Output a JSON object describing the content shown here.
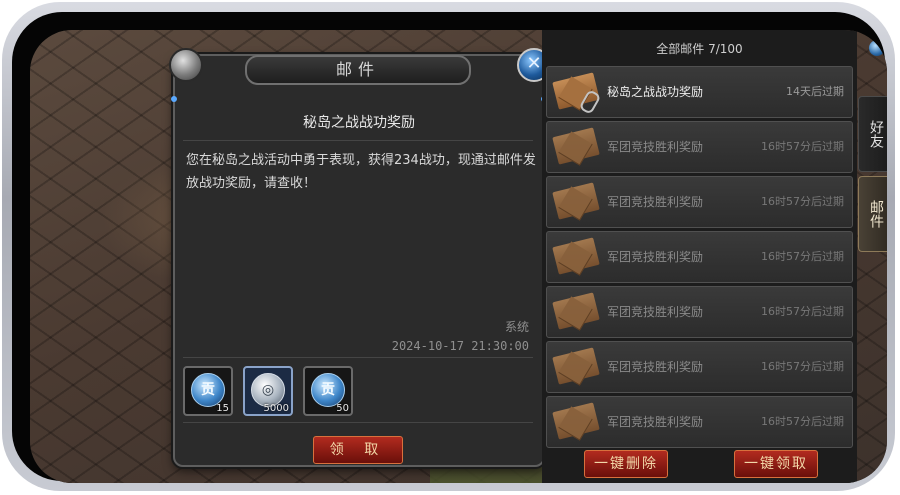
{
  "detail": {
    "window_title": "邮件",
    "close_symbol": "✕",
    "mail_title": "秘岛之战战功奖励",
    "mail_body": "您在秘岛之战活动中勇于表现，获得234战功，现通过邮件发放战功奖励，请查收！",
    "sender": "系统",
    "date": "2024-10-17 21:30:00",
    "rewards": [
      {
        "icon": "contribution-icon",
        "glyph": "贡",
        "count": "15"
      },
      {
        "icon": "silver-coin-icon",
        "glyph": "◎",
        "count": "5000"
      },
      {
        "icon": "contribution-icon",
        "glyph": "贡",
        "count": "50"
      }
    ],
    "claim_label": "领 取"
  },
  "list": {
    "header": "全部邮件 7/100",
    "items": [
      {
        "name": "秘岛之战战功奖励",
        "expire": "14天后过期",
        "attachment": true
      },
      {
        "name": "军团竞技胜利奖励",
        "expire": "16时57分后过期"
      },
      {
        "name": "军团竞技胜利奖励",
        "expire": "16时57分后过期"
      },
      {
        "name": "军团竞技胜利奖励",
        "expire": "16时57分后过期"
      },
      {
        "name": "军团竞技胜利奖励",
        "expire": "16时57分后过期"
      },
      {
        "name": "军团竞技胜利奖励",
        "expire": "16时57分后过期"
      },
      {
        "name": "军团竞技胜利奖励",
        "expire": "16时57分后过期"
      }
    ],
    "delete_all_label": "一键删除",
    "claim_all_label": "一键领取"
  },
  "tabs": [
    {
      "label": "好友"
    },
    {
      "label": "邮件"
    }
  ]
}
